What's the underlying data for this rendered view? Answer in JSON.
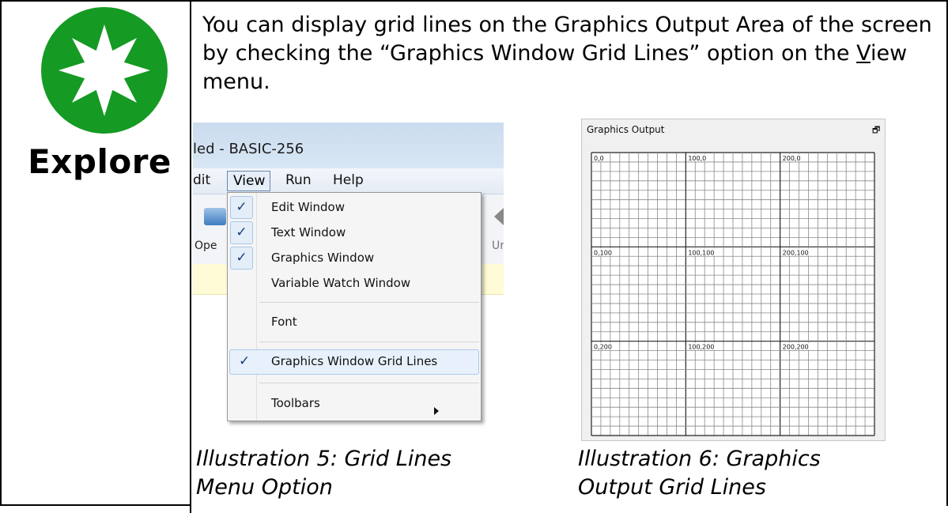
{
  "explore": {
    "label": "Explore",
    "icon": "star-badge-icon",
    "colors": {
      "badge": "#159a23",
      "star": "#ffffff"
    }
  },
  "intro": {
    "text_before": "You can display grid lines on the Graphics Output Area of the screen by checking the “Graphics Window Grid Lines” option on the ",
    "menu_mnemonic": "V",
    "menu_rest": "iew",
    "text_after": " menu."
  },
  "illustration5": {
    "window_title": "led - BASIC-256",
    "menubar": [
      "dit",
      "View",
      "Run",
      "Help"
    ],
    "toolbar_labels": {
      "open": "Ope",
      "undo": "Ur"
    },
    "menu_items": [
      {
        "label": "Edit Window",
        "checked": true
      },
      {
        "label": "Text Window",
        "checked": true
      },
      {
        "label": "Graphics Window",
        "checked": true
      },
      {
        "label": "Variable Watch Window",
        "checked": false
      },
      {
        "label": "Font",
        "checked": false
      },
      {
        "label": "Graphics Window Grid Lines",
        "checked": true,
        "highlighted": true
      },
      {
        "label": "Toolbars",
        "checked": false,
        "submenu": true
      }
    ],
    "check_glyph": "✓",
    "caption_line1": "Illustration 5: Grid Lines",
    "caption_line2": "Menu Option"
  },
  "illustration6": {
    "panel_title": "Graphics Output",
    "float_glyph": "🗗",
    "grid_labels": [
      [
        "0,0",
        "100,0",
        "200,0"
      ],
      [
        "0,100",
        "100,100",
        "200,100"
      ],
      [
        "0,200",
        "100,200",
        "200,200"
      ]
    ],
    "caption_line1": "Illustration 6: Graphics",
    "caption_line2": "Output Grid Lines"
  }
}
